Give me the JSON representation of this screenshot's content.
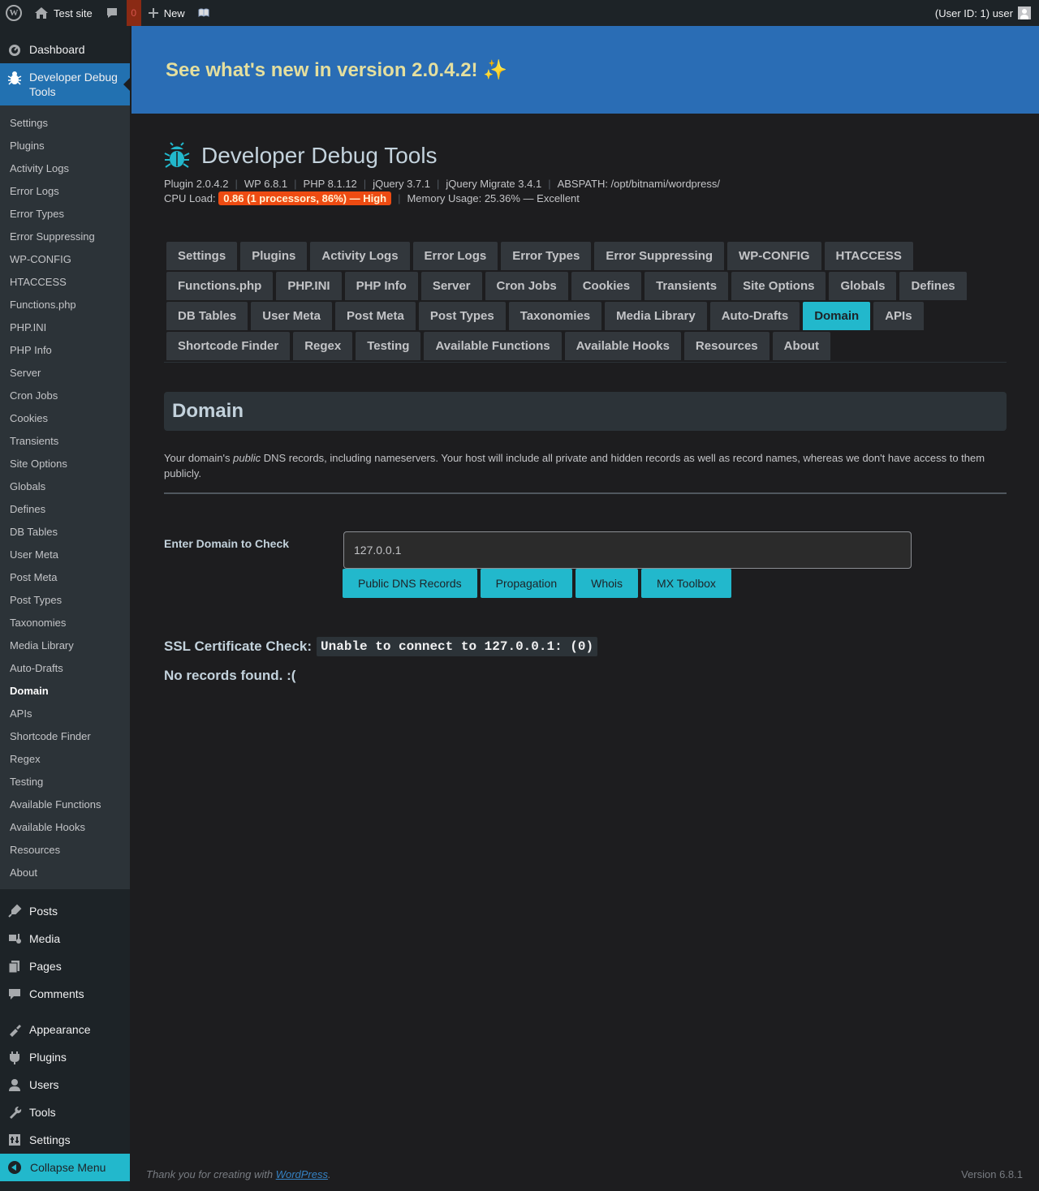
{
  "adminbar": {
    "site_name": "Test site",
    "comment_count": "0",
    "new_label": "New",
    "user_label": "(User ID: 1) user"
  },
  "sidebar": {
    "dashboard": "Dashboard",
    "current_menu": "Developer Debug Tools",
    "submenu": [
      "Settings",
      "Plugins",
      "Activity Logs",
      "Error Logs",
      "Error Types",
      "Error Suppressing",
      "WP-CONFIG",
      "HTACCESS",
      "Functions.php",
      "PHP.INI",
      "PHP Info",
      "Server",
      "Cron Jobs",
      "Cookies",
      "Transients",
      "Site Options",
      "Globals",
      "Defines",
      "DB Tables",
      "User Meta",
      "Post Meta",
      "Post Types",
      "Taxonomies",
      "Media Library",
      "Auto-Drafts",
      "Domain",
      "APIs",
      "Shortcode Finder",
      "Regex",
      "Testing",
      "Available Functions",
      "Available Hooks",
      "Resources",
      "About"
    ],
    "current_submenu": "Domain",
    "menu_group1": [
      "Posts",
      "Media",
      "Pages",
      "Comments"
    ],
    "menu_group2": [
      "Appearance",
      "Plugins",
      "Users",
      "Tools",
      "Settings"
    ],
    "collapse": "Collapse Menu"
  },
  "banner": {
    "text": "See what's new in version 2.0.4.2! ✨"
  },
  "header": {
    "title": "Developer Debug Tools",
    "plugin": "Plugin 2.0.4.2",
    "wp": "WP 6.8.1",
    "php": "PHP 8.1.12",
    "jquery": "jQuery 3.7.1",
    "jquery_migrate": "jQuery Migrate 3.4.1",
    "abspath": "ABSPATH: /opt/bitnami/wordpress/",
    "cpu_label": "CPU Load:",
    "cpu_value": "0.86 (1 processors, 86%) — High",
    "memory": "Memory Usage: 25.36% — Excellent"
  },
  "tabs": [
    "Settings",
    "Plugins",
    "Activity Logs",
    "Error Logs",
    "Error Types",
    "Error Suppressing",
    "WP-CONFIG",
    "HTACCESS",
    "Functions.php",
    "PHP.INI",
    "PHP Info",
    "Server",
    "Cron Jobs",
    "Cookies",
    "Transients",
    "Site Options",
    "Globals",
    "Defines",
    "DB Tables",
    "User Meta",
    "Post Meta",
    "Post Types",
    "Taxonomies",
    "Media Library",
    "Auto-Drafts",
    "Domain",
    "APIs",
    "Shortcode Finder",
    "Regex",
    "Testing",
    "Available Functions",
    "Available Hooks",
    "Resources",
    "About"
  ],
  "active_tab": "Domain",
  "section": {
    "title": "Domain",
    "desc_before": "Your domain's ",
    "desc_em": "public",
    "desc_after": " DNS records, including nameservers. Your host will include all private and hidden records as well as record names, whereas we don't have access to them publicly.",
    "field_label": "Enter Domain to Check",
    "domain_value": "127.0.0.1",
    "buttons": [
      "Public DNS Records",
      "Propagation",
      "Whois",
      "MX Toolbox"
    ],
    "ssl_label": "SSL Certificate Check:",
    "ssl_result": "Unable to connect to 127.0.0.1: (0)",
    "no_records": "No records found. :("
  },
  "footer": {
    "thanks_before": "Thank you for creating with ",
    "thanks_link": "WordPress",
    "thanks_after": ".",
    "version": "Version 6.8.1"
  },
  "colors": {
    "accent": "#22b8cc",
    "banner": "#2a6db5",
    "current_menu": "#2271b1",
    "cpu_high": "#ee4b12"
  }
}
